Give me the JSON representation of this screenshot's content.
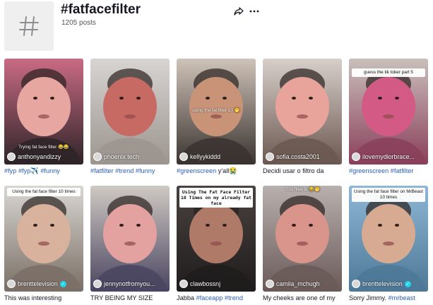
{
  "header": {
    "icon": "hashtag-icon",
    "title": "#fatfacefilter",
    "posts": "1205 posts",
    "share_icon": "share-icon",
    "more_icon": "more-icon"
  },
  "videos": [
    {
      "overlay": "",
      "creator": "anthonyandizzy",
      "verified": false,
      "caption": [
        {
          "t": "#fyp",
          "tag": true
        },
        {
          "t": " ",
          "tag": false
        },
        {
          "t": "#fyp",
          "tag": true
        },
        {
          "t": "✈️",
          "tag": false
        },
        {
          "t": " #funny",
          "tag": true
        }
      ],
      "bg": [
        "#c96b84",
        "#2e2428"
      ],
      "face": "#e7a7a0",
      "inner_text": "Trying fat face filter 😂😂"
    },
    {
      "overlay": "",
      "creator": "phoenix.tech",
      "verified": false,
      "caption": [
        {
          "t": "#fatfilter",
          "tag": true
        },
        {
          "t": " ",
          "tag": false
        },
        {
          "t": "#trend",
          "tag": true
        },
        {
          "t": " ",
          "tag": false
        },
        {
          "t": "#funny",
          "tag": true
        }
      ],
      "bg": [
        "#d8d4d2",
        "#9c958f"
      ],
      "face": "#c86a64",
      "inner_text": ""
    },
    {
      "overlay": "",
      "creator": "kellyykiddd",
      "verified": false,
      "caption": [
        {
          "t": "#greenscreen",
          "tag": true
        },
        {
          "t": " y'all😭",
          "tag": false
        }
      ],
      "bg": [
        "#cfc3b8",
        "#3a3330"
      ],
      "face": "#c99378",
      "inner_text": "using the fat filter 10 🤭"
    },
    {
      "overlay": "",
      "creator": "sofia.costa2001",
      "verified": false,
      "caption": [
        {
          "t": "Decidi usar o filtro da",
          "tag": false
        }
      ],
      "bg": [
        "#d8cfca",
        "#6b5850"
      ],
      "face": "#e8a39a",
      "inner_text": ""
    },
    {
      "overlay": "guess the tik toker part 5",
      "creator": "ilovemydiorbrace...",
      "verified": false,
      "caption": [
        {
          "t": "#greenscreen",
          "tag": true
        },
        {
          "t": " ",
          "tag": false
        },
        {
          "t": "#fatfilter",
          "tag": true
        }
      ],
      "bg": [
        "#c9bfbb",
        "#8a3f5a"
      ],
      "face": "#d45a86",
      "inner_text": ""
    },
    {
      "overlay": "Using the fat face filter 10 times",
      "creator": "brenttelevision",
      "verified": true,
      "caption": [
        {
          "t": "This was interesting",
          "tag": false
        }
      ],
      "bg": [
        "#d9d6d2",
        "#7a6f66"
      ],
      "face": "#d8b29c",
      "inner_text": ""
    },
    {
      "overlay": "",
      "creator": "jennynotfromyou...",
      "verified": false,
      "caption": [
        {
          "t": "TRY BEING MY SIZE",
          "tag": false
        }
      ],
      "bg": [
        "#cfc9c3",
        "#4a4560"
      ],
      "face": "#e3a2a0",
      "inner_text": ""
    },
    {
      "overlay": "Using The Fat Face Filter 10 Times on my already fat face",
      "creator": "clawbossnj",
      "verified": false,
      "caption": [
        {
          "t": "Jabba ",
          "tag": false
        },
        {
          "t": "#faceapp",
          "tag": true
        },
        {
          "t": " ",
          "tag": false
        },
        {
          "t": "#trend",
          "tag": true
        }
      ],
      "bg": [
        "#4a4240",
        "#1f1c1c"
      ],
      "face": "#b07a68",
      "inner_text": ""
    },
    {
      "overlay": "This filter is 😂🤭",
      "creator": "camila_mchugh",
      "verified": false,
      "caption": [
        {
          "t": "My cheeks are one of my",
          "tag": false
        }
      ],
      "bg": [
        "#b8b0ae",
        "#6a5a58"
      ],
      "face": "#d9958b",
      "inner_text": ""
    },
    {
      "overlay": "Using the fat face filter on MrBeast 10 times",
      "creator": "brenttelevision",
      "verified": true,
      "caption": [
        {
          "t": "Sorry Jimmy. ",
          "tag": false
        },
        {
          "t": "#mrbeast",
          "tag": true
        }
      ],
      "bg": [
        "#8fb6d6",
        "#4d7896"
      ],
      "face": "#d7ab92",
      "inner_text": ""
    }
  ]
}
